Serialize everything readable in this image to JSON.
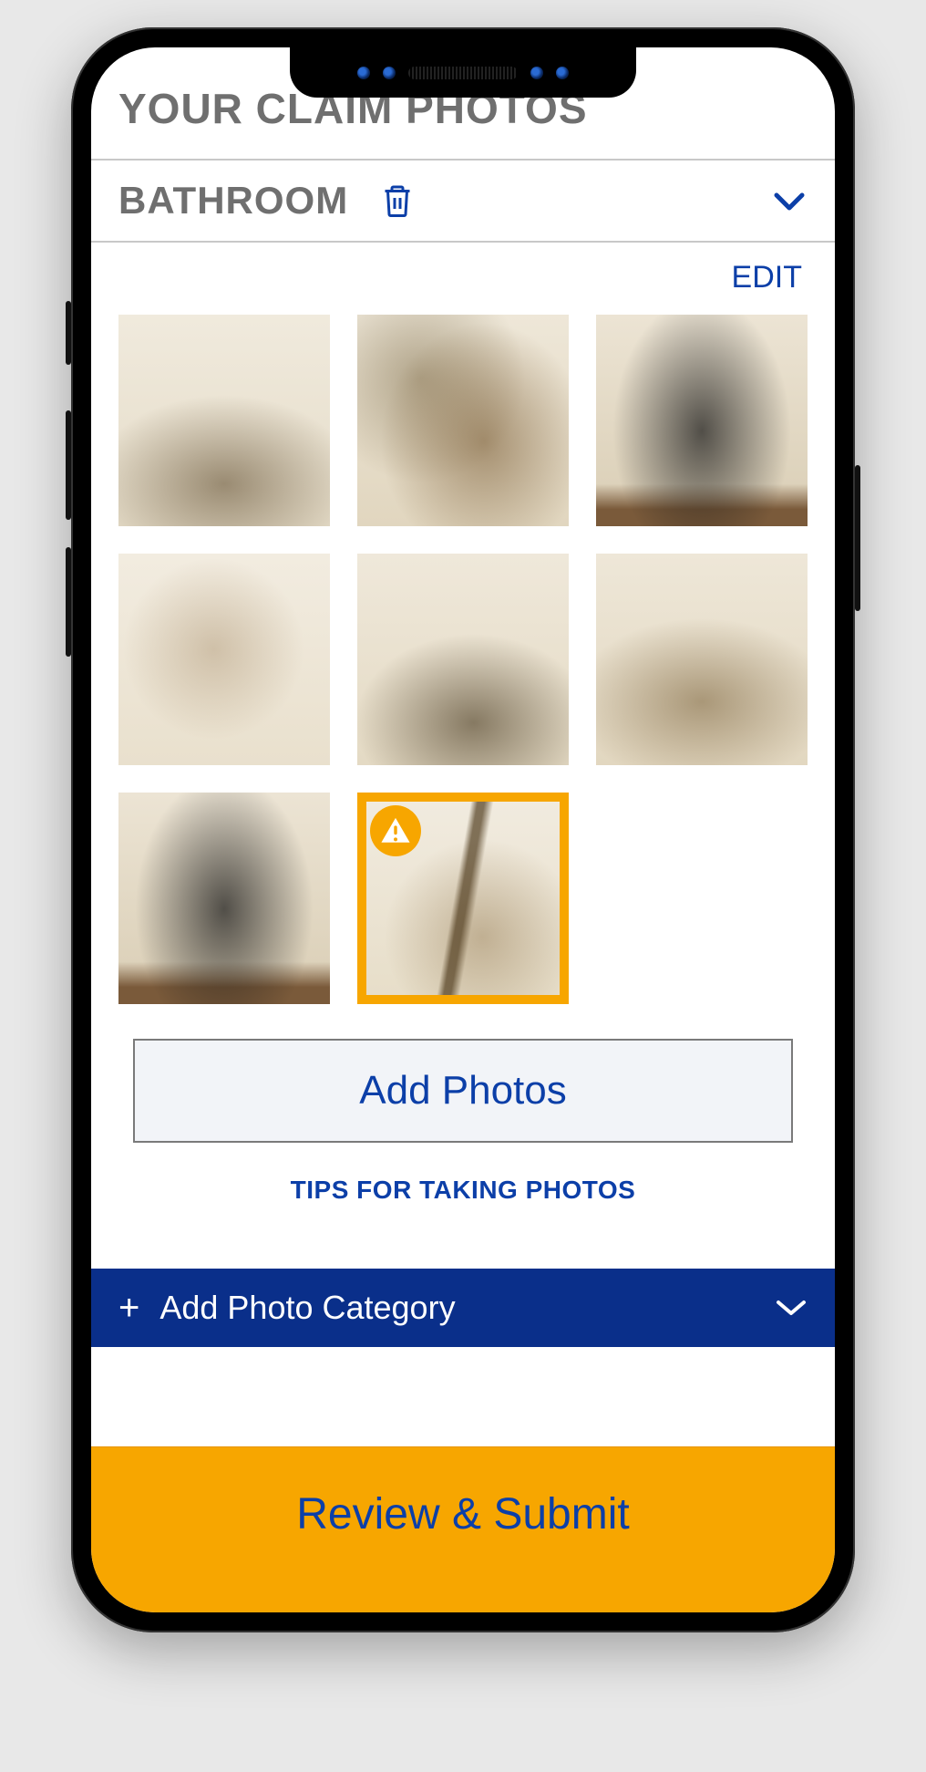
{
  "colors": {
    "brand_blue": "#0c3fa8",
    "brand_orange": "#f7a600",
    "text_grey": "#6f6f6f"
  },
  "header": {
    "page_title": "YOUR CLAIM PHOTOS"
  },
  "category": {
    "name": "BATHROOM",
    "delete_icon": "trash-icon",
    "expand_icon": "chevron-down-icon",
    "edit_label": "EDIT"
  },
  "photos": [
    {
      "alt": "damage photo 1",
      "flagged": false
    },
    {
      "alt": "damage photo 2",
      "flagged": false
    },
    {
      "alt": "damage photo 3",
      "flagged": false
    },
    {
      "alt": "damage photo 4",
      "flagged": false
    },
    {
      "alt": "damage photo 5",
      "flagged": false
    },
    {
      "alt": "damage photo 6",
      "flagged": false
    },
    {
      "alt": "damage photo 7",
      "flagged": false
    },
    {
      "alt": "damage photo 8",
      "flagged": true,
      "badge_icon": "warning-icon"
    }
  ],
  "actions": {
    "add_photos_label": "Add Photos",
    "tips_label": "TIPS FOR TAKING PHOTOS",
    "add_category_label": "Add Photo Category",
    "submit_label": "Review & Submit"
  }
}
